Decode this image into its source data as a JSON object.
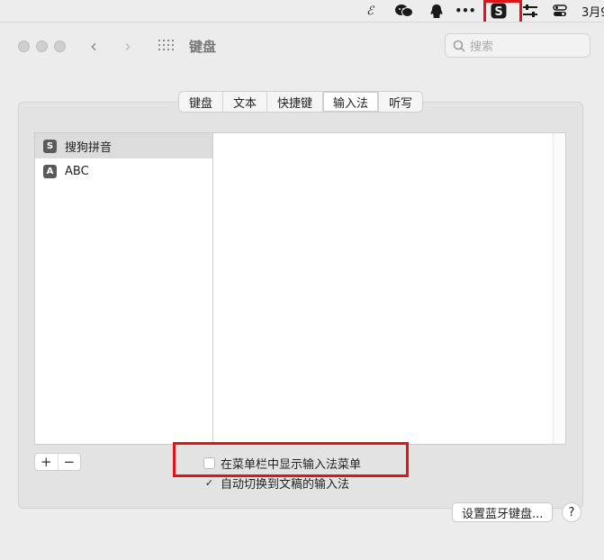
{
  "menubar": {
    "items": [
      {
        "name": "evernote-icon",
        "glyph": "ℰ"
      },
      {
        "name": "wechat-icon",
        "glyph": ""
      },
      {
        "name": "qq-icon",
        "glyph": ""
      },
      {
        "name": "more-icon",
        "glyph": "•••"
      },
      {
        "name": "sogou-input-icon",
        "glyph": "S"
      },
      {
        "name": "sliders-icon",
        "glyph": ""
      },
      {
        "name": "control-center-icon",
        "glyph": ""
      }
    ],
    "date": "3月9"
  },
  "window": {
    "title": "键盘",
    "search_placeholder": "搜索"
  },
  "tabs": [
    "键盘",
    "文本",
    "快捷键",
    "输入法",
    "听写"
  ],
  "active_tab": "输入法",
  "input_sources": [
    {
      "label": "搜狗拼音",
      "icon": "S",
      "selected": true
    },
    {
      "label": "ABC",
      "icon": "A",
      "selected": false
    }
  ],
  "add_label": "+",
  "remove_label": "−",
  "options": {
    "show_menu": {
      "label": "在菜单栏中显示输入法菜单",
      "checked": false
    },
    "auto_switch": {
      "label": "自动切换到文稿的输入法",
      "checked": true
    }
  },
  "bluetooth_button": "设置蓝牙键盘...",
  "help_label": "?",
  "colors": {
    "highlight": "#e0141b"
  }
}
